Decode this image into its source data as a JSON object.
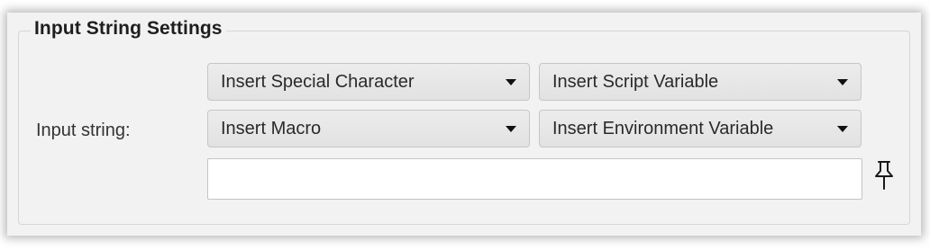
{
  "group": {
    "title": "Input String Settings"
  },
  "input_string": {
    "label": "Input string:",
    "value": "",
    "placeholder": ""
  },
  "dropdowns": {
    "special_character": "Insert Special Character",
    "script_variable": "Insert Script Variable",
    "macro": "Insert Macro",
    "environment_variable": "Insert Environment Variable"
  },
  "icons": {
    "dropdown_caret": "caret-down-icon",
    "pin": "pin-icon"
  }
}
